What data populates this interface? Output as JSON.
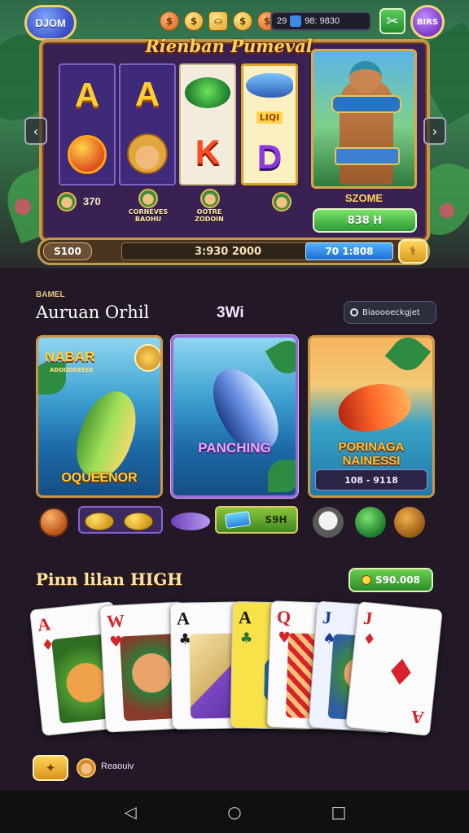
{
  "top_bar": {
    "logo_text": "DJOM",
    "resource_symbols": [
      "$",
      "$",
      "⛀",
      "$",
      "$"
    ],
    "counter_left": "29",
    "counter_right": "98: 9830",
    "tool_icon": "✂",
    "profile_text": "BIRS"
  },
  "slot": {
    "title": "Rienban Pumeval",
    "reels": [
      {
        "top": "A",
        "bottom_type": "coin"
      },
      {
        "top": "A",
        "bottom_type": "face"
      },
      {
        "top_type": "frog",
        "bottom": "K"
      },
      {
        "top_type": "fish",
        "tag": "LIQI",
        "bottom": "D"
      }
    ],
    "info_num": "370",
    "info_tag_1": "CORNEVES BAOHU",
    "info_tag_2": "OOTRE ZODOIN",
    "hero_label": "SZOME",
    "hero_button": "838 H",
    "left_arrow": "‹",
    "right_arrow": "›"
  },
  "bet_bar": {
    "left": "S100",
    "center": "3:930 2000",
    "right": "70 1:808",
    "spin_icon": "⚕"
  },
  "games": {
    "tag": "BAMEL",
    "title": "Auruan Orhil",
    "count": "3Wi",
    "filter_text": "Biaoooeckgjet",
    "cards": [
      {
        "name": "card-nabar",
        "title_top": "NABAR",
        "title_sub": "ADDDDDEEEE",
        "label": "OQUEENOR"
      },
      {
        "name": "card-panching",
        "label": "PANCHING"
      },
      {
        "name": "card-porinaca",
        "label": "PORINAGA NAINESSI",
        "strip": "108 - 9118"
      }
    ],
    "chip_button": "S9H"
  },
  "hand": {
    "title": "Pinn lilan HIGH",
    "badge": "S90.008",
    "cards": [
      {
        "rank": "A",
        "color": "red",
        "suit": "♦"
      },
      {
        "rank": "W",
        "color": "red",
        "suit": "♥"
      },
      {
        "rank": "A",
        "color": "black",
        "suit": "♣"
      },
      {
        "rank": "A",
        "color": "black",
        "suit": "♣"
      },
      {
        "rank": "Q",
        "color": "red",
        "suit": "♥"
      },
      {
        "rank": "J",
        "color": "blue",
        "suit": "♠"
      },
      {
        "rank": "J",
        "color": "red",
        "suit": "♦",
        "big_suit": "♦",
        "rank_bottom": "A"
      }
    ]
  },
  "bottom_strip": {
    "button_icon": "✦",
    "text": "Reaouiv"
  },
  "nav": {
    "back": "◁",
    "home": "○",
    "recent": "□"
  }
}
